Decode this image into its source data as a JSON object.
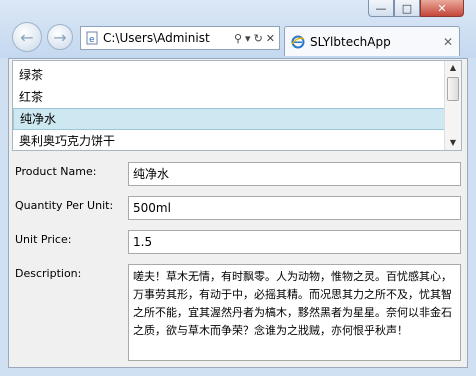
{
  "browser": {
    "address": "C:\\Users\\Administ",
    "tab_title": "SLYlbtechApp",
    "win_min": "—",
    "win_max": "□",
    "win_close": "✕",
    "addr_search": "⚲",
    "addr_dropdown": "▾",
    "addr_refresh": "↻",
    "addr_stop": "✕",
    "tab_close": "✕"
  },
  "products": {
    "items": [
      "绿茶",
      "红茶",
      "纯净水",
      "奥利奥巧克力饼干"
    ],
    "selected_index": 2
  },
  "form": {
    "product_name_label": "Product Name:",
    "product_name_value": "纯净水",
    "quantity_label": "Quantity Per Unit:",
    "quantity_value": "500ml",
    "price_label": "Unit Price:",
    "price_value": "1.5",
    "description_label": "Description:",
    "description_value": "嗟夫！草木无情，有时飘零。人为动物，惟物之灵。百忧感其心，万事劳其形，有动于中，必摇其精。而况思其力之所不及，忧其智之所不能，宜其渥然丹者为槁木，黟然黑者为星星。奈何以非金石之质，欲与草木而争荣？念谁为之戕贼，亦何恨乎秋声！"
  }
}
